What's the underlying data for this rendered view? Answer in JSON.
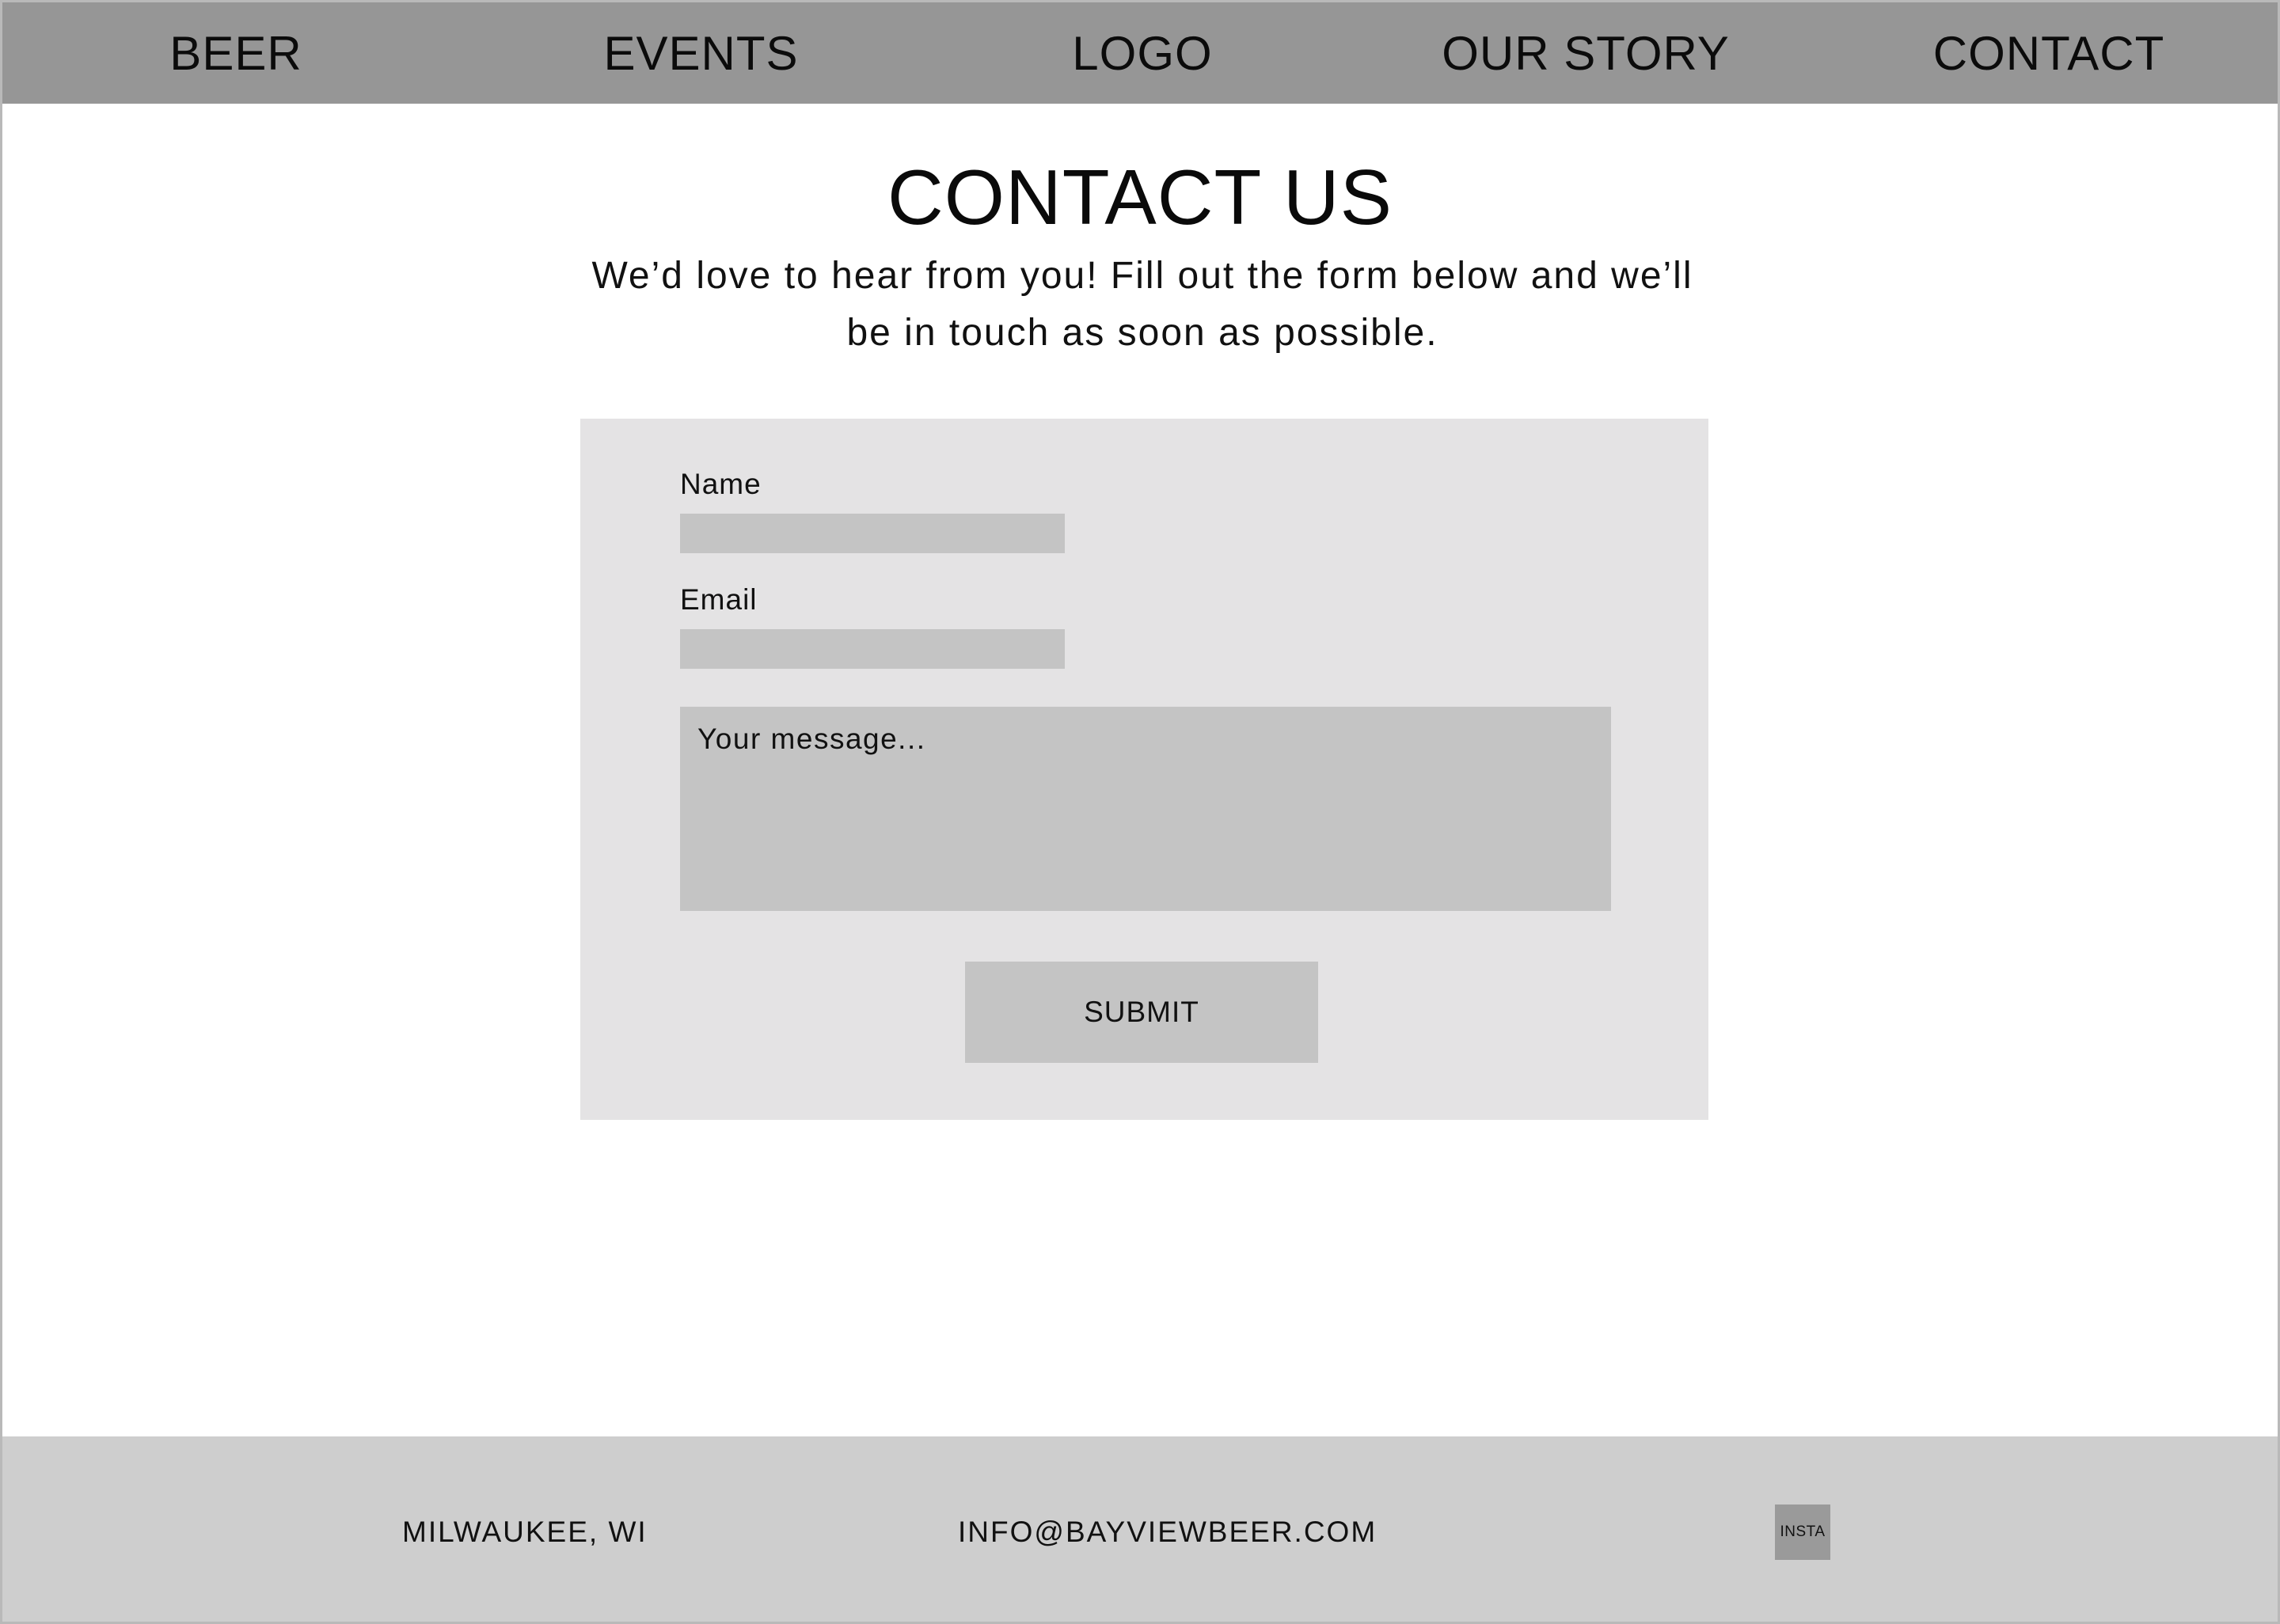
{
  "nav": {
    "beer": "BEER",
    "events": "EVENTS",
    "logo": "LOGO",
    "our_story": "OUR STORY",
    "contact": "CONTACT"
  },
  "page": {
    "title": "CONTACT US",
    "intro_line1": "We’d love to hear from you!  Fill out the form below and we’ll",
    "intro_line2": "be in touch as soon as possible."
  },
  "form": {
    "name_label": "Name",
    "name_value": "",
    "email_label": "Email",
    "email_value": "",
    "message_placeholder": "Your message...",
    "submit_label": "SUBMIT"
  },
  "footer": {
    "location": "MILWAUKEE, WI",
    "email": "INFO@BAYVIEWBEER.COM",
    "social_label": "INSTA"
  },
  "colors": {
    "nav_bg": "#969696",
    "panel_bg": "#e4e3e4",
    "input_bg": "#c4c4c4",
    "footer_bg": "#cecece",
    "insta_bg": "#9a9a9a"
  }
}
